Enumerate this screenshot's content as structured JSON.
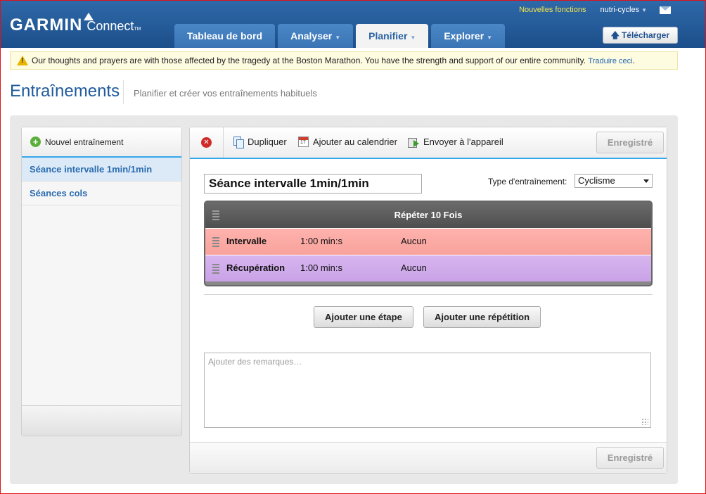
{
  "header": {
    "logo_brand": "GARMIN",
    "logo_product": "Connect",
    "logo_tm": "TM",
    "new_features": "Nouvelles fonctions",
    "username": "nutri-cycles",
    "tabs": [
      {
        "label": "Tableau de bord",
        "has_caret": false
      },
      {
        "label": "Analyser",
        "has_caret": true
      },
      {
        "label": "Planifier",
        "has_caret": true,
        "active": true
      },
      {
        "label": "Explorer",
        "has_caret": true
      }
    ],
    "upload_label": "Télécharger"
  },
  "notice": {
    "text": "Our thoughts and prayers are with those affected by the tragedy at the Boston Marathon. You have the strength and support of our entire community.",
    "translate": "Traduire ceci",
    "suffix": "."
  },
  "page": {
    "title": "Entraînements",
    "subtitle": "Planifier et créer vos entraînements habituels"
  },
  "sidebar": {
    "new_workout": "Nouvel entraînement",
    "items": [
      {
        "label": "Séance intervalle 1min/1min",
        "active": true
      },
      {
        "label": "Séances cols",
        "active": false
      }
    ]
  },
  "toolbar": {
    "duplicate": "Dupliquer",
    "add_calendar": "Ajouter au calendrier",
    "send_device": "Envoyer à l'appareil",
    "saved": "Enregistré"
  },
  "workout": {
    "name": "Séance intervalle 1min/1min",
    "type_label": "Type d'entraînement:",
    "type_value": "Cyclisme",
    "repeat_label": "Répéter 10 Fois",
    "steps": [
      {
        "name": "Intervalle",
        "duration": "1:00 min:s",
        "target": "Aucun"
      },
      {
        "name": "Récupération",
        "duration": "1:00 min:s",
        "target": "Aucun"
      }
    ],
    "add_step": "Ajouter une étape",
    "add_repeat": "Ajouter une répétition",
    "notes_placeholder": "Ajouter des remarques…"
  },
  "footer": {
    "saved": "Enregistré"
  }
}
